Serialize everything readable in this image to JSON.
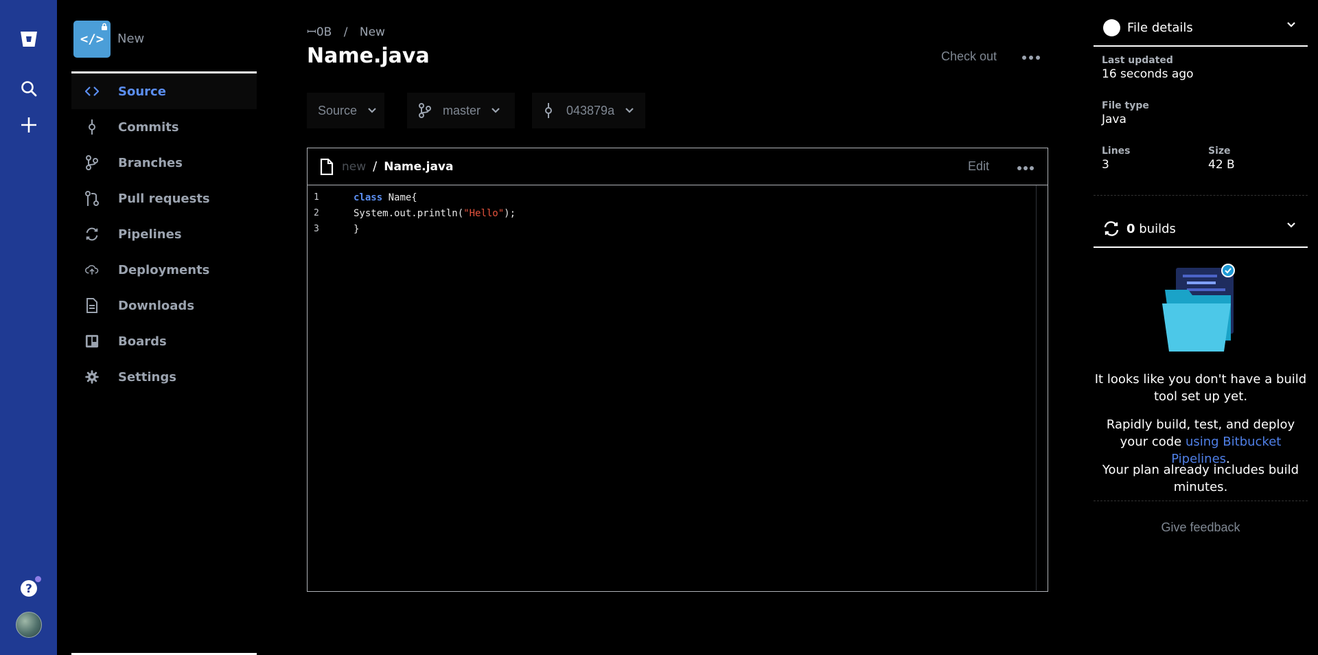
{
  "repo": {
    "name": "New"
  },
  "nav": [
    {
      "label": "Source",
      "icon": "source-code-icon"
    },
    {
      "label": "Commits",
      "icon": "commit-icon"
    },
    {
      "label": "Branches",
      "icon": "branch-icon"
    },
    {
      "label": "Pull requests",
      "icon": "pull-request-icon"
    },
    {
      "label": "Pipelines",
      "icon": "pipelines-icon"
    },
    {
      "label": "Deployments",
      "icon": "cloud-upload-icon"
    },
    {
      "label": "Downloads",
      "icon": "document-icon"
    },
    {
      "label": "Boards",
      "icon": "board-icon"
    },
    {
      "label": "Settings",
      "icon": "gear-icon"
    }
  ],
  "breadcrumb": {
    "workspace": "ꟷ0B",
    "repo": "New",
    "separator": "/"
  },
  "page": {
    "title": "Name.java",
    "checkout_label": "Check out"
  },
  "selectors": {
    "view": "Source",
    "branch": "master",
    "commit": "043879a"
  },
  "file": {
    "dir": "new",
    "separator": "/",
    "name": "Name.java",
    "edit_label": "Edit",
    "lines": [
      {
        "n": "1",
        "kw": "class",
        "text": " Name{",
        "str": "",
        "tail": ""
      },
      {
        "n": "2",
        "kw": "",
        "text": "System.out.println(",
        "str": "\"Hello\"",
        "tail": ");"
      },
      {
        "n": "3",
        "kw": "",
        "text": "}",
        "str": "",
        "tail": ""
      }
    ]
  },
  "details": {
    "header": "File details",
    "last_updated_label": "Last updated",
    "last_updated_value": "16 seconds ago",
    "file_type_label": "File type",
    "file_type_value": "Java",
    "lines_label": "Lines",
    "lines_value": "3",
    "size_label": "Size",
    "size_value": "42 B"
  },
  "builds": {
    "count": "0",
    "label": "builds",
    "msg1": "It looks like you don't have a build tool set up yet.",
    "msg2_prefix": "Rapidly build, test, and deploy your code ",
    "msg2_link": "using Bitbucket Pipelines",
    "msg2_suffix": ".",
    "msg3": "Your plan already includes build minutes.",
    "feedback": "Give feedback"
  },
  "colors": {
    "rail": "#1f3a93",
    "accent": "#5b8ef0",
    "link": "#4f7fe6",
    "string": "#e5533d",
    "repo_tile": "#4b9ed8"
  }
}
